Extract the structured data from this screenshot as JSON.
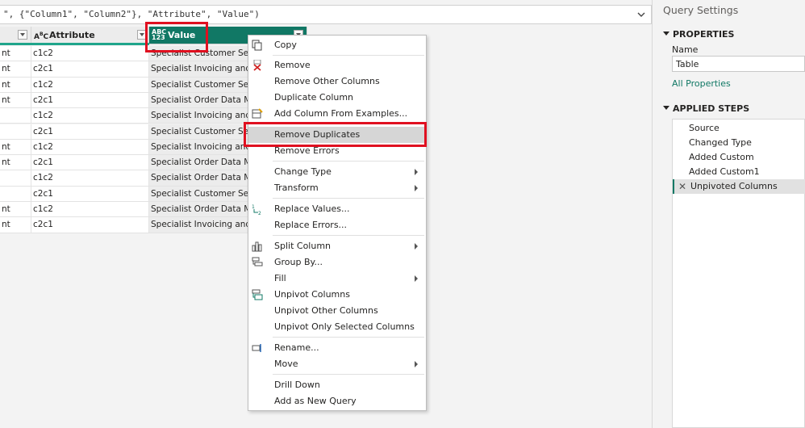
{
  "formula": {
    "text": "\", {\"Column1\", \"Column2\"}, \"Attribute\", \"Value\")"
  },
  "grid": {
    "headers": [
      {
        "label": "",
        "type": ""
      },
      {
        "label": "Attribute",
        "type": "ABC"
      },
      {
        "label": "Value",
        "type": "ABC 123"
      }
    ],
    "rows": [
      [
        "nt",
        "c1c2",
        "Specialist Customer Servic"
      ],
      [
        "nt",
        "c2c1",
        "Specialist Invoicing and Se"
      ],
      [
        "nt",
        "c1c2",
        "Specialist Customer Servic"
      ],
      [
        "nt",
        "c2c1",
        "Specialist Order Data Man"
      ],
      [
        "",
        "c1c2",
        "Specialist Invoicing and Se"
      ],
      [
        "",
        "c2c1",
        "Specialist Customer Servi"
      ],
      [
        "nt",
        "c1c2",
        "Specialist Invoicing and Se"
      ],
      [
        "nt",
        "c2c1",
        "Specialist Order Data Man"
      ],
      [
        "",
        "c1c2",
        "Specialist Order Data Man"
      ],
      [
        "",
        "c2c1",
        "Specialist Customer Servic"
      ],
      [
        "nt",
        "c1c2",
        "Specialist Order Data Man"
      ],
      [
        "nt",
        "c2c1",
        "Specialist Invoicing and Se"
      ]
    ]
  },
  "menu": {
    "items": [
      {
        "label": "Copy",
        "icon": "copy-icon"
      },
      {
        "label": "Remove",
        "icon": "remove-column-icon"
      },
      {
        "label": "Remove Other Columns",
        "icon": ""
      },
      {
        "label": "Duplicate Column",
        "icon": ""
      },
      {
        "label": "Add Column From Examples...",
        "icon": "column-from-examples-icon"
      },
      {
        "label": "Remove Duplicates",
        "icon": ""
      },
      {
        "label": "Remove Errors",
        "icon": ""
      },
      {
        "label": "Change Type",
        "icon": ""
      },
      {
        "label": "Transform",
        "icon": ""
      },
      {
        "label": "Replace Values...",
        "icon": "replace-values-icon"
      },
      {
        "label": "Replace Errors...",
        "icon": ""
      },
      {
        "label": "Split Column",
        "icon": "split-column-icon"
      },
      {
        "label": "Group By...",
        "icon": "group-by-icon"
      },
      {
        "label": "Fill",
        "icon": ""
      },
      {
        "label": "Unpivot Columns",
        "icon": "unpivot-icon"
      },
      {
        "label": "Unpivot Other Columns",
        "icon": ""
      },
      {
        "label": "Unpivot Only Selected Columns",
        "icon": ""
      },
      {
        "label": "Rename...",
        "icon": "rename-icon"
      },
      {
        "label": "Move",
        "icon": ""
      },
      {
        "label": "Drill Down",
        "icon": ""
      },
      {
        "label": "Add as New Query",
        "icon": ""
      }
    ],
    "highlighted": "Remove Duplicates"
  },
  "pane": {
    "title": "Query Settings",
    "properties_heading": "PROPERTIES",
    "name_label": "Name",
    "name_value": "Table",
    "all_properties": "All Properties",
    "steps_heading": "APPLIED STEPS",
    "steps": [
      "Source",
      "Changed Type",
      "Added Custom",
      "Added Custom1",
      "Unpivoted Columns"
    ],
    "active_step": "Unpivoted Columns"
  },
  "colors": {
    "accent": "#117865",
    "highlight_box": "#e01020",
    "header_teal": "#1fa58b"
  }
}
